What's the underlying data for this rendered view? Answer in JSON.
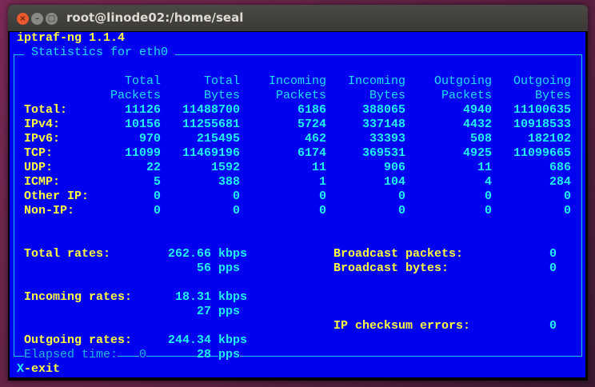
{
  "window": {
    "title": "root@linode02:/home/seal",
    "close": "×",
    "minimize": "–",
    "maximize": "□"
  },
  "app": {
    "name": "iptraf-ng 1.1.4",
    "panel_title": " Statistics for eth0 ",
    "exit_hint_key": "X",
    "exit_hint_label": "-exit"
  },
  "table": {
    "headers": [
      [
        "Total",
        "Packets"
      ],
      [
        "Total",
        "Bytes"
      ],
      [
        "Incoming",
        "Packets"
      ],
      [
        "Incoming",
        "Bytes"
      ],
      [
        "Outgoing",
        "Packets"
      ],
      [
        "Outgoing",
        "Bytes"
      ]
    ],
    "rows": [
      {
        "label": "Total:",
        "values": [
          "11126",
          "11488700",
          "6186",
          "388065",
          "4940",
          "11100635"
        ]
      },
      {
        "label": "IPv4:",
        "values": [
          "10156",
          "11255681",
          "5724",
          "337148",
          "4432",
          "10918533"
        ]
      },
      {
        "label": "IPv6:",
        "values": [
          "970",
          "215495",
          "462",
          "33393",
          "508",
          "182102"
        ]
      },
      {
        "label": "TCP:",
        "values": [
          "11099",
          "11469196",
          "6174",
          "369531",
          "4925",
          "11099665"
        ]
      },
      {
        "label": "UDP:",
        "values": [
          "22",
          "1592",
          "11",
          "906",
          "11",
          "686"
        ]
      },
      {
        "label": "ICMP:",
        "values": [
          "5",
          "388",
          "1",
          "104",
          "4",
          "284"
        ]
      },
      {
        "label": "Other IP:",
        "values": [
          "0",
          "0",
          "0",
          "0",
          "0",
          "0"
        ]
      },
      {
        "label": "Non-IP:",
        "values": [
          "0",
          "0",
          "0",
          "0",
          "0",
          "0"
        ]
      }
    ]
  },
  "rates": {
    "total_label": "Total rates:",
    "total_kbps": "262.66",
    "total_pps": "56",
    "incoming_label": "Incoming rates:",
    "incoming_kbps": "18.31",
    "incoming_pps": "27",
    "outgoing_label": "Outgoing rates:",
    "outgoing_kbps": "244.34",
    "outgoing_pps": "28",
    "kbps_unit": "kbps",
    "pps_unit": "pps"
  },
  "broadcast": {
    "packets_label": "Broadcast packets:",
    "packets": "0",
    "bytes_label": "Broadcast bytes:",
    "bytes": "0",
    "checksum_label": "IP checksum errors:",
    "checksum": "0"
  },
  "elapsed": {
    "label": "Elapsed time:",
    "value": "0"
  }
}
